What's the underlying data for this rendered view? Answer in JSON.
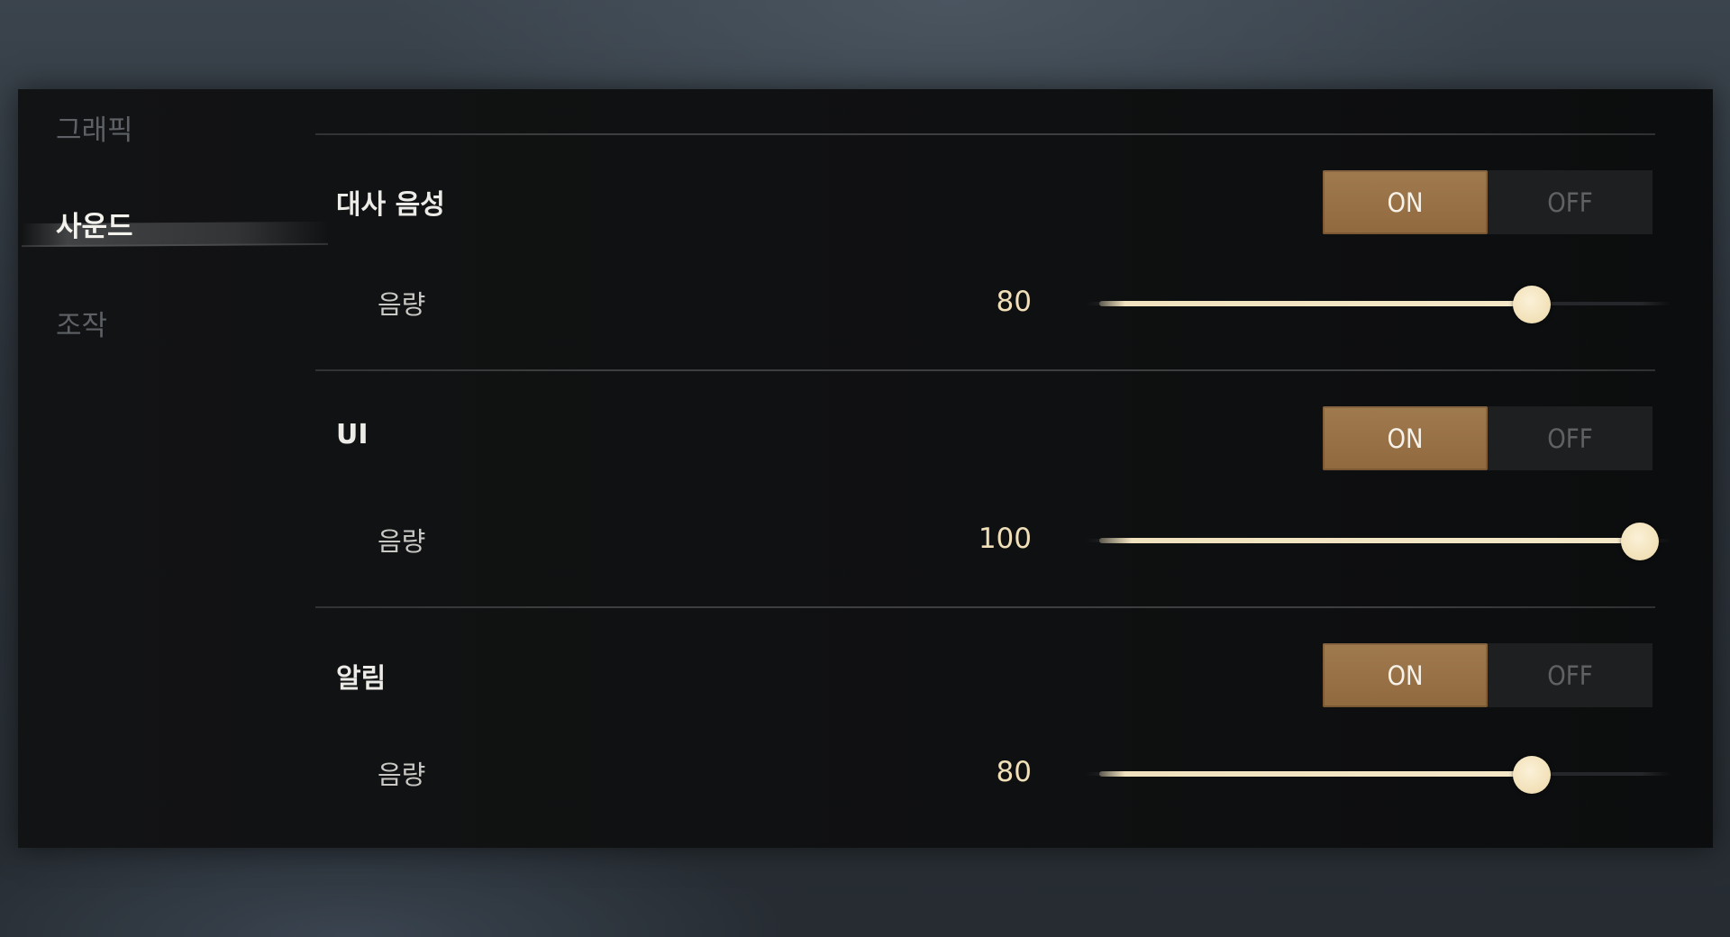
{
  "sidebar": {
    "items": [
      {
        "label": "그래픽",
        "active": false
      },
      {
        "label": "사운드",
        "active": true
      },
      {
        "label": "조작",
        "active": false
      }
    ]
  },
  "sections": [
    {
      "label": "대사 음성",
      "toggle": {
        "on": "ON",
        "off": "OFF",
        "selected": "ON"
      },
      "volume": {
        "label": "음량",
        "value": "80",
        "fraction": 0.8
      }
    },
    {
      "label": "UI",
      "toggle": {
        "on": "ON",
        "off": "OFF",
        "selected": "ON"
      },
      "volume": {
        "label": "음량",
        "value": "100",
        "fraction": 1.0
      }
    },
    {
      "label": "알림",
      "toggle": {
        "on": "ON",
        "off": "OFF",
        "selected": "ON"
      },
      "volume": {
        "label": "음량",
        "value": "80",
        "fraction": 0.8
      }
    }
  ],
  "colors": {
    "accent": "#9c7548",
    "slider_fill": "#f2e4c2",
    "value_text": "#f0dfb8"
  }
}
